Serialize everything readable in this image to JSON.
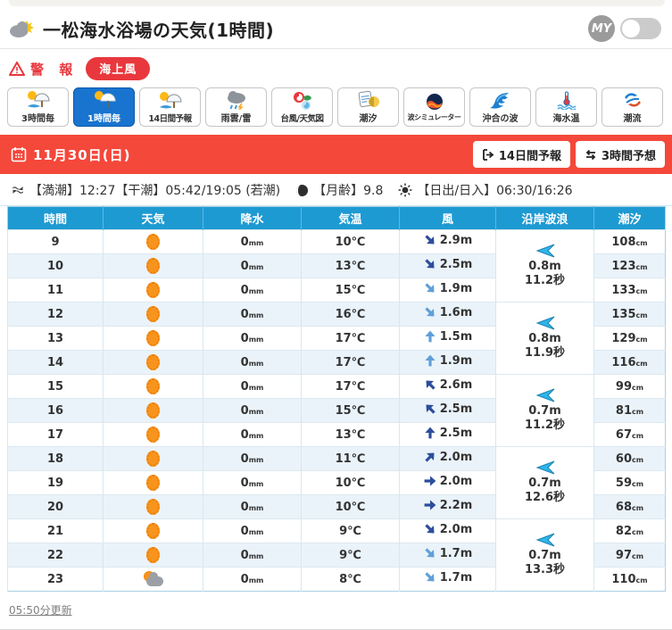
{
  "colors": {
    "accent_red": "#f4483b",
    "warning_red": "#e8383d",
    "tab_active_blue": "#1874cf",
    "table_header_blue": "#1e9ad2",
    "row_alt_blue": "#eaf3fa",
    "wind_strong": "#2c4d9c",
    "wind_weak": "#5f9fd8",
    "wave_arrow_cyan": "#2fb5e8",
    "sun_orange": "#f7941e",
    "link_gray": "#808080"
  },
  "header": {
    "title": "一松海水浴場の天気(1時間)",
    "my_label": "MY",
    "my_toggle_state": "off"
  },
  "alert": {
    "label": "警 報",
    "badge": "海上風"
  },
  "tabs": [
    {
      "label": "3時間毎",
      "icon": "sun-umbrella-rain",
      "active": false
    },
    {
      "label": "1時間毎",
      "icon": "sun-umbrella",
      "active": true
    },
    {
      "label": "14日間予報",
      "icon": "sun-umbrella-rain",
      "active": false
    },
    {
      "label": "雨雲/雷",
      "icon": "raincloud-lightning",
      "active": false
    },
    {
      "label": "台風/天気図",
      "icon": "typhoon-map",
      "active": false
    },
    {
      "label": "潮汐",
      "icon": "tide-calendar-moon",
      "active": false
    },
    {
      "label": "波シミュレーター",
      "icon": "wave-simulator-globe",
      "active": false
    },
    {
      "label": "沖合の波",
      "icon": "offshore-wave",
      "active": false
    },
    {
      "label": "海水温",
      "icon": "sea-thermometer",
      "active": false
    },
    {
      "label": "潮流",
      "icon": "current-swirl",
      "active": false
    }
  ],
  "date_bar": {
    "date": "11月30日(日)",
    "buttons": [
      {
        "label": "14日間予報",
        "icon": "forward-14day"
      },
      {
        "label": "3時間予想",
        "icon": "swap-3hour"
      }
    ]
  },
  "tide_info": {
    "tide_text": "【満潮】12:27【干潮】05:42/19:05 (若潮)",
    "moon_text": "【月齢】9.8",
    "sunrise_text": "【日出/日入】06:30/16:26"
  },
  "table": {
    "headers": [
      "時間",
      "天気",
      "降水",
      "気温",
      "風",
      "沿岸波浪",
      "潮汐"
    ],
    "rows": [
      {
        "hour": "9",
        "weather": "sunny",
        "precip": {
          "value": "0",
          "unit": "mm"
        },
        "temp": "10℃",
        "wind": {
          "speed": "2.9m",
          "dir_deg": 45,
          "dir": "southeast",
          "strength": "strong"
        },
        "tide": {
          "value": "108",
          "unit": "cm"
        }
      },
      {
        "hour": "10",
        "weather": "sunny",
        "precip": {
          "value": "0",
          "unit": "mm"
        },
        "temp": "13℃",
        "wind": {
          "speed": "2.5m",
          "dir_deg": 45,
          "dir": "southeast",
          "strength": "strong"
        },
        "tide": {
          "value": "123",
          "unit": "cm"
        }
      },
      {
        "hour": "11",
        "weather": "sunny",
        "precip": {
          "value": "0",
          "unit": "mm"
        },
        "temp": "15℃",
        "wind": {
          "speed": "1.9m",
          "dir_deg": 45,
          "dir": "southeast",
          "strength": "weak"
        },
        "tide": {
          "value": "133",
          "unit": "cm"
        }
      },
      {
        "hour": "12",
        "weather": "sunny",
        "precip": {
          "value": "0",
          "unit": "mm"
        },
        "temp": "16℃",
        "wind": {
          "speed": "1.6m",
          "dir_deg": 45,
          "dir": "southeast",
          "strength": "weak"
        },
        "tide": {
          "value": "135",
          "unit": "cm"
        }
      },
      {
        "hour": "13",
        "weather": "sunny",
        "precip": {
          "value": "0",
          "unit": "mm"
        },
        "temp": "17℃",
        "wind": {
          "speed": "1.5m",
          "dir_deg": -90,
          "dir": "north",
          "strength": "weak"
        },
        "tide": {
          "value": "129",
          "unit": "cm"
        }
      },
      {
        "hour": "14",
        "weather": "sunny",
        "precip": {
          "value": "0",
          "unit": "mm"
        },
        "temp": "17℃",
        "wind": {
          "speed": "1.9m",
          "dir_deg": -90,
          "dir": "north",
          "strength": "weak"
        },
        "tide": {
          "value": "116",
          "unit": "cm"
        }
      },
      {
        "hour": "15",
        "weather": "sunny",
        "precip": {
          "value": "0",
          "unit": "mm"
        },
        "temp": "17℃",
        "wind": {
          "speed": "2.6m",
          "dir_deg": -135,
          "dir": "northwest",
          "strength": "strong"
        },
        "tide": {
          "value": "99",
          "unit": "cm"
        }
      },
      {
        "hour": "16",
        "weather": "sunny",
        "precip": {
          "value": "0",
          "unit": "mm"
        },
        "temp": "15℃",
        "wind": {
          "speed": "2.5m",
          "dir_deg": -135,
          "dir": "northwest",
          "strength": "strong"
        },
        "tide": {
          "value": "81",
          "unit": "cm"
        }
      },
      {
        "hour": "17",
        "weather": "sunny",
        "precip": {
          "value": "0",
          "unit": "mm"
        },
        "temp": "13℃",
        "wind": {
          "speed": "2.5m",
          "dir_deg": -90,
          "dir": "north",
          "strength": "strong"
        },
        "tide": {
          "value": "67",
          "unit": "cm"
        }
      },
      {
        "hour": "18",
        "weather": "sunny",
        "precip": {
          "value": "0",
          "unit": "mm"
        },
        "temp": "11℃",
        "wind": {
          "speed": "2.0m",
          "dir_deg": -45,
          "dir": "northeast",
          "strength": "strong"
        },
        "tide": {
          "value": "60",
          "unit": "cm"
        }
      },
      {
        "hour": "19",
        "weather": "sunny",
        "precip": {
          "value": "0",
          "unit": "mm"
        },
        "temp": "10℃",
        "wind": {
          "speed": "2.0m",
          "dir_deg": 0,
          "dir": "east",
          "strength": "strong"
        },
        "tide": {
          "value": "59",
          "unit": "cm"
        }
      },
      {
        "hour": "20",
        "weather": "sunny",
        "precip": {
          "value": "0",
          "unit": "mm"
        },
        "temp": "10℃",
        "wind": {
          "speed": "2.2m",
          "dir_deg": 0,
          "dir": "east",
          "strength": "strong"
        },
        "tide": {
          "value": "68",
          "unit": "cm"
        }
      },
      {
        "hour": "21",
        "weather": "sunny",
        "precip": {
          "value": "0",
          "unit": "mm"
        },
        "temp": "9℃",
        "wind": {
          "speed": "2.0m",
          "dir_deg": 45,
          "dir": "southeast",
          "strength": "strong"
        },
        "tide": {
          "value": "82",
          "unit": "cm"
        }
      },
      {
        "hour": "22",
        "weather": "sunny",
        "precip": {
          "value": "0",
          "unit": "mm"
        },
        "temp": "9℃",
        "wind": {
          "speed": "1.7m",
          "dir_deg": 45,
          "dir": "southeast",
          "strength": "weak"
        },
        "tide": {
          "value": "97",
          "unit": "cm"
        }
      },
      {
        "hour": "23",
        "weather": "sun-cloud",
        "precip": {
          "value": "0",
          "unit": "mm"
        },
        "temp": "8℃",
        "wind": {
          "speed": "1.7m",
          "dir_deg": 45,
          "dir": "southeast",
          "strength": "weak"
        },
        "tide": {
          "value": "110",
          "unit": "cm"
        }
      }
    ],
    "wave_groups": [
      {
        "height": "0.8m",
        "period": "11.2秒",
        "direction": "left"
      },
      {
        "height": "0.8m",
        "period": "11.9秒",
        "direction": "left"
      },
      {
        "height": "0.7m",
        "period": "11.2秒",
        "direction": "left"
      },
      {
        "height": "0.7m",
        "period": "12.6秒",
        "direction": "left"
      },
      {
        "height": "0.7m",
        "period": "13.3秒",
        "direction": "left"
      }
    ]
  },
  "footer": {
    "updated": "05:50分更新"
  }
}
